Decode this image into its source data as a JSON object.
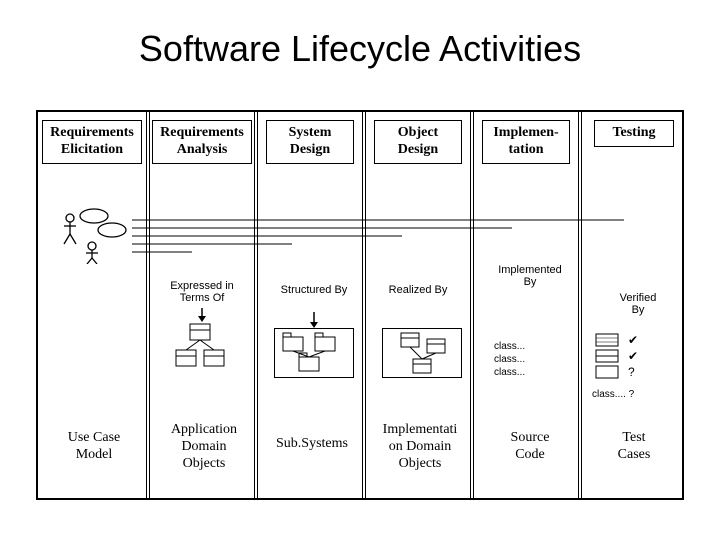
{
  "title": "Software Lifecycle Activities",
  "columns": [
    {
      "header": "Requirements\nElicitation",
      "artifact": "Use Case\nModel"
    },
    {
      "header": "Requirements\nAnalysis",
      "artifact": "Application\nDomain\nObjects"
    },
    {
      "header": "System\nDesign",
      "artifact": "Sub.Systems"
    },
    {
      "header": "Object\nDesign",
      "artifact": "Implementati\non Domain\nObjects"
    },
    {
      "header": "Implemen-\ntation",
      "artifact": "Source\nCode"
    },
    {
      "header": "Testing",
      "artifact": "Test\nCases"
    }
  ],
  "links": [
    "Expressed in\nTerms Of",
    "Structured By",
    "Realized By",
    "Implemented\nBy",
    "Verified\nBy"
  ],
  "classlabel": "class...\nclass...\nclass...",
  "classlabel_extra": "class.... ?"
}
